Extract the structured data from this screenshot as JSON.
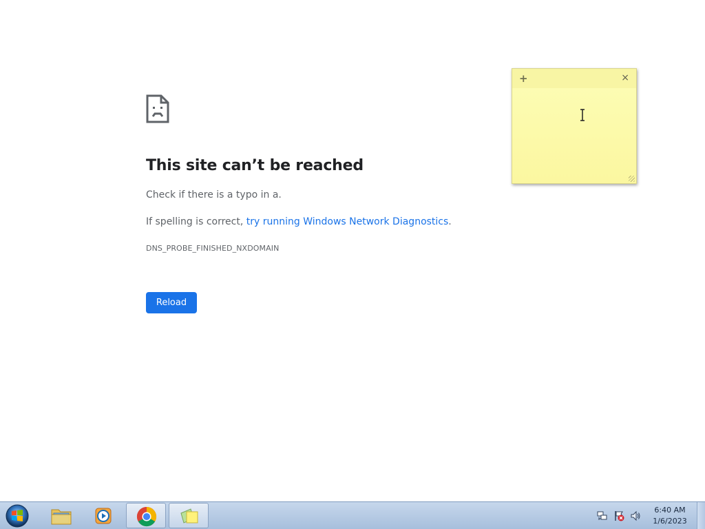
{
  "error_page": {
    "title": "This site can’t be reached",
    "line1": "Check if there is a typo in a.",
    "line2_prefix": "If spelling is correct, ",
    "line2_link": "try running Windows Network Diagnostics",
    "line2_suffix": ".",
    "error_code": "DNS_PROBE_FINISHED_NXDOMAIN",
    "reload_label": "Reload",
    "icon": "sad-page-icon"
  },
  "sticky_note": {
    "add_symbol": "+",
    "close_symbol": "×",
    "text": ""
  },
  "taskbar": {
    "items": [
      {
        "name": "start",
        "icon": "windows-start-orb"
      },
      {
        "name": "file-explorer",
        "icon": "folder-icon"
      },
      {
        "name": "media-player",
        "icon": "media-player-icon"
      },
      {
        "name": "chrome",
        "icon": "chrome-icon"
      },
      {
        "name": "sticky-notes",
        "icon": "sticky-notes-icon"
      }
    ],
    "clock": {
      "time": "6:40 AM",
      "date": "1/6/2023"
    }
  },
  "colors": {
    "link": "#1a73e8",
    "button": "#1a73e8",
    "sticky": "#fdfdb6"
  }
}
